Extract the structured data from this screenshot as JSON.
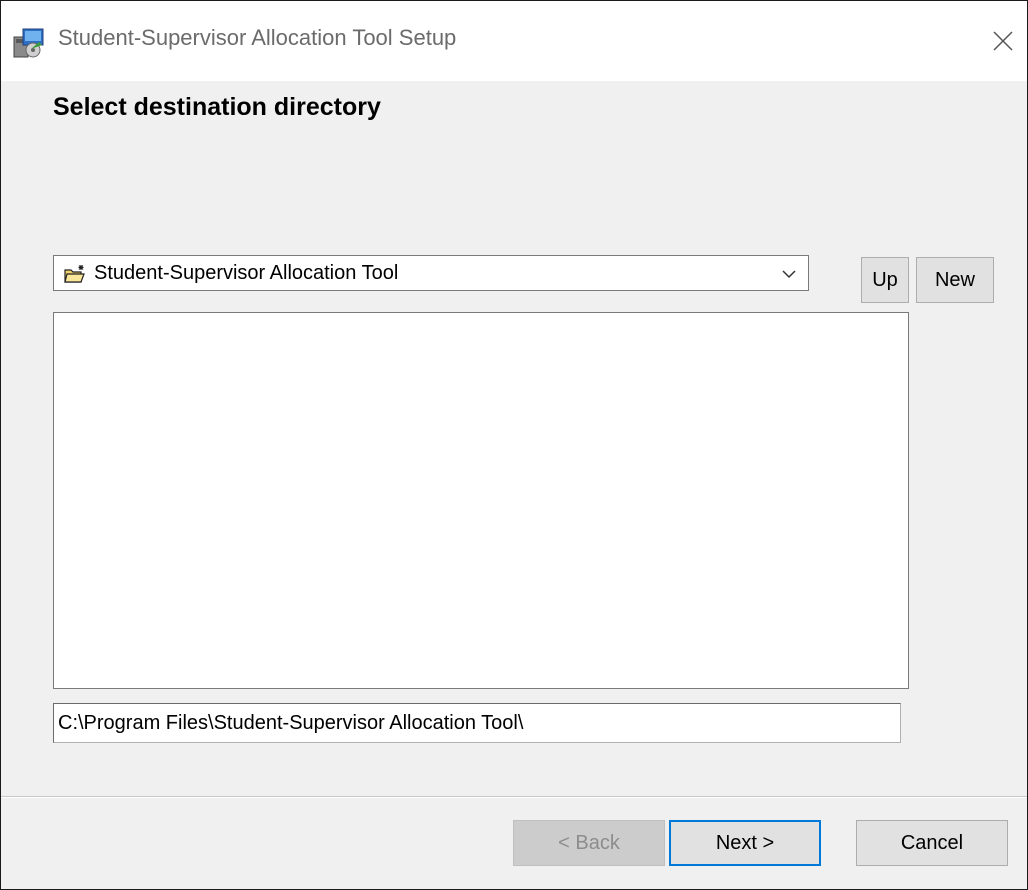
{
  "window": {
    "title": "Student-Supervisor Allocation Tool Setup",
    "heading": "Select destination directory"
  },
  "directory_combo": {
    "selected": "Student-Supervisor Allocation Tool"
  },
  "nav_buttons": {
    "up_label": "Up",
    "new_label": "New"
  },
  "path_field": {
    "value": "C:\\Program Files\\Student-Supervisor Allocation Tool\\"
  },
  "footer": {
    "back_label": "< Back",
    "next_label": "Next >",
    "cancel_label": "Cancel"
  },
  "icons": {
    "app": "installer-icon",
    "close": "close-icon",
    "folder": "new-folder-icon",
    "dropdown": "chevron-down-icon"
  },
  "colors": {
    "accent": "#0078d7",
    "dialog_bg": "#f0f0f0",
    "button_bg": "#e1e1e1"
  }
}
